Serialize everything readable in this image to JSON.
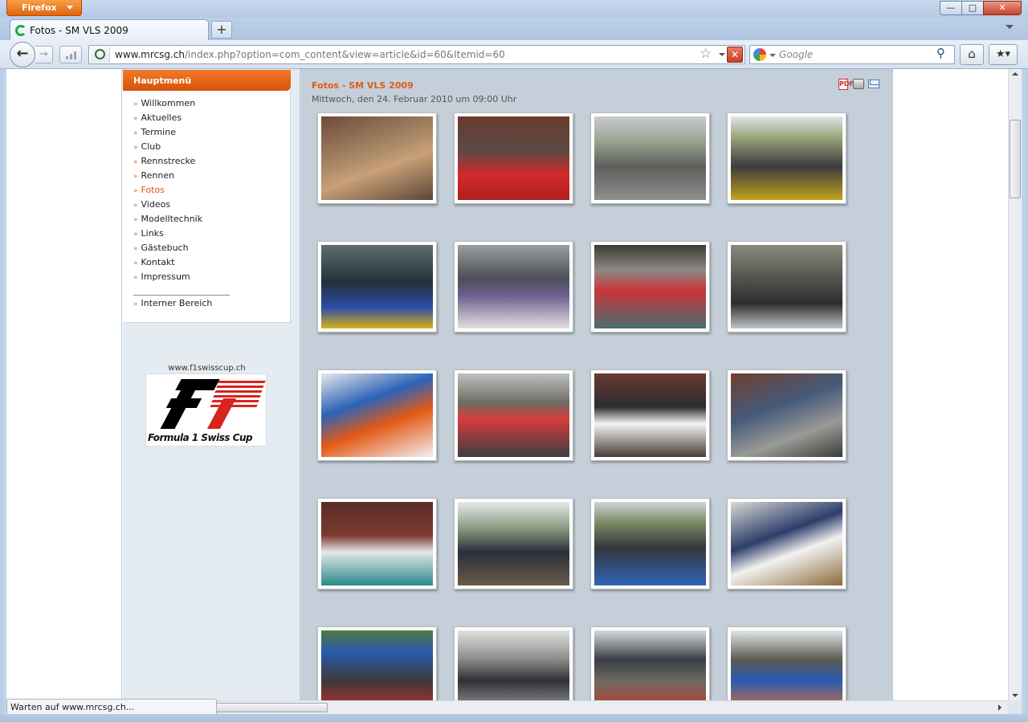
{
  "browser": {
    "menu_label": "Firefox",
    "tab_title": "Fotos - SM VLS 2009",
    "new_tab_label": "+",
    "url_domain": "www.mrcsg.ch",
    "url_path": "/index.php?option=com_content&view=article&id=60&Itemid=60",
    "search_placeholder": "Google",
    "status_text": "Warten auf www.mrcsg.ch..."
  },
  "sidebar": {
    "menu_title": "Hauptmenü",
    "items": [
      {
        "label": "Willkommen"
      },
      {
        "label": "Aktuelles"
      },
      {
        "label": "Termine"
      },
      {
        "label": "Club"
      },
      {
        "label": "Rennstrecke"
      },
      {
        "label": "Rennen"
      },
      {
        "label": "Fotos",
        "active": true
      },
      {
        "label": "Videos"
      },
      {
        "label": "Modelltechnik"
      },
      {
        "label": "Links"
      },
      {
        "label": "Gästebuch"
      },
      {
        "label": "Kontakt"
      },
      {
        "label": "Impressum"
      }
    ],
    "internal": {
      "label": "Interner Bereich"
    },
    "sponsor_url": "www.f1swisscup.ch",
    "sponsor_logo_text": "Formula 1 Swiss Cup"
  },
  "article": {
    "title": "Fotos - SM VLS 2009",
    "date": "Mittwoch, den 24. Februar 2010 um 09:00 Uhr",
    "pdf_icon": "PDF",
    "photo_count": 20
  },
  "colors": {
    "accent": "#e15a15",
    "content_bg": "#c4cfd9",
    "sidebar_bg": "#e4ebf1"
  }
}
